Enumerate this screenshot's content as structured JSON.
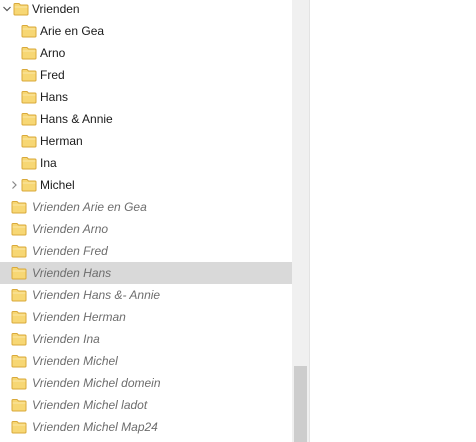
{
  "tree": {
    "parent": {
      "label": "Vrienden",
      "expanded": true,
      "icon": "folder-icon"
    },
    "children": [
      {
        "label": "Arie en Gea",
        "expandable": false
      },
      {
        "label": "Arno",
        "expandable": false
      },
      {
        "label": "Fred",
        "expandable": false
      },
      {
        "label": "Hans",
        "expandable": false
      },
      {
        "label": "Hans & Annie",
        "expandable": false
      },
      {
        "label": "Herman",
        "expandable": false
      },
      {
        "label": "Ina",
        "expandable": false
      },
      {
        "label": "Michel",
        "expandable": true
      }
    ],
    "siblings": [
      {
        "label": "Vrienden Arie en Gea",
        "hovered": false
      },
      {
        "label": "Vrienden Arno",
        "hovered": false
      },
      {
        "label": "Vrienden Fred",
        "hovered": false
      },
      {
        "label": "Vrienden Hans",
        "hovered": true
      },
      {
        "label": "Vrienden Hans &- Annie",
        "hovered": false
      },
      {
        "label": "Vrienden Herman",
        "hovered": false
      },
      {
        "label": "Vrienden Ina",
        "hovered": false
      },
      {
        "label": "Vrienden Michel",
        "hovered": false
      },
      {
        "label": "Vrienden Michel domein",
        "hovered": false
      },
      {
        "label": "Vrienden Michel ladot",
        "hovered": false
      },
      {
        "label": "Vrienden Michel Map24",
        "hovered": false
      }
    ]
  },
  "colors": {
    "folder_fill": "#f7d774",
    "folder_edge": "#d9a93a",
    "hover_row": "#d9d9d9",
    "dim_text": "#6d6d6d",
    "scroll_track": "#f0f0f0",
    "scroll_thumb": "#cdcdcd"
  },
  "scrollbar": {
    "position_fraction": 0.83,
    "visible_fraction": 0.17
  }
}
